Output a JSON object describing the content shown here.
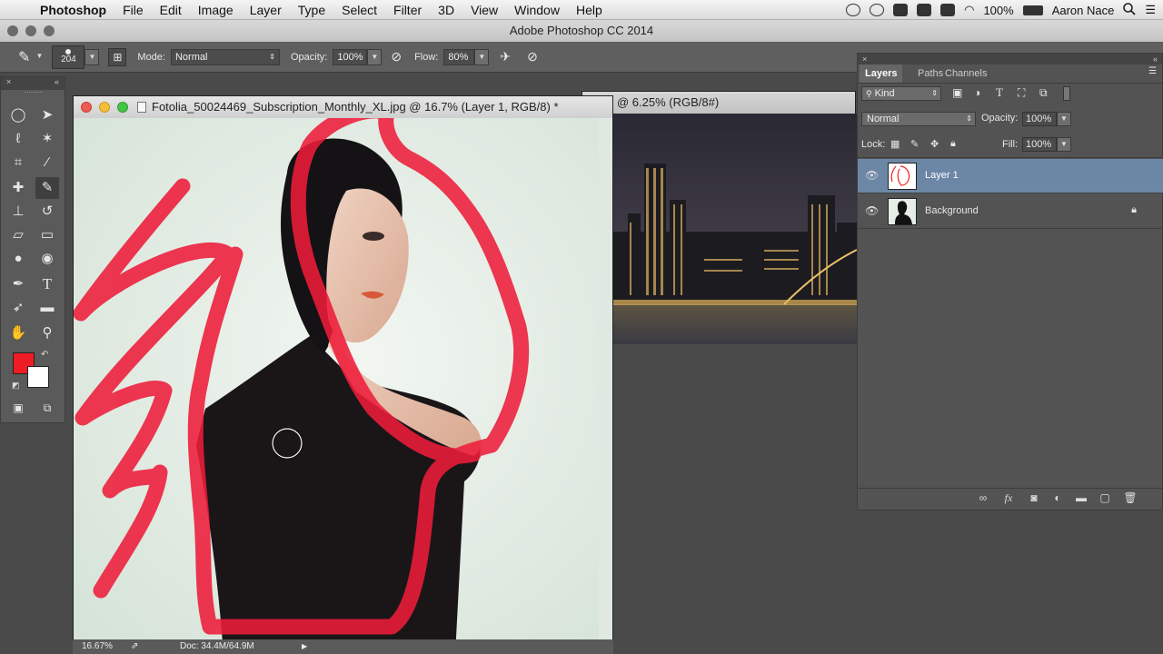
{
  "menubar": {
    "apple": "",
    "app": "Photoshop",
    "items": [
      "File",
      "Edit",
      "Image",
      "Layer",
      "Type",
      "Select",
      "Filter",
      "3D",
      "View",
      "Window",
      "Help"
    ],
    "battery": "100%",
    "user": "Aaron Nace"
  },
  "app_title": "Adobe Photoshop CC 2014",
  "options": {
    "brush_size": "204",
    "mode_label": "Mode:",
    "mode_value": "Normal",
    "opacity_label": "Opacity:",
    "opacity_value": "100%",
    "flow_label": "Flow:",
    "flow_value": "80%"
  },
  "toolbox": {
    "tools": [
      "marquee-icon",
      "move-icon",
      "lasso-icon",
      "magic-wand-icon",
      "crop-icon",
      "eyedropper-icon",
      "healing-icon",
      "brush-icon",
      "stamp-icon",
      "history-brush-icon",
      "eraser-icon",
      "gradient-icon",
      "blur-icon",
      "dodge-icon",
      "pen-icon",
      "type-icon",
      "path-select-icon",
      "shape-icon",
      "hand-icon",
      "zoom-icon"
    ],
    "foreground_color": "#ee1c24",
    "background_color": "#ffffff"
  },
  "documents": [
    {
      "title": "Fotolia_50024469_Subscription_Monthly_XL.jpg @ 16.7% (Layer 1, RGB/8) *",
      "zoom": "16.67%",
      "doc_info": "Doc: 34.4M/64.9M"
    },
    {
      "title_tail": "@ 6.25% (RGB/8#)"
    }
  ],
  "layers_panel": {
    "tabs": [
      "Layers",
      "Paths",
      "Channels"
    ],
    "kind_label": "Kind",
    "blend_mode": "Normal",
    "opacity_label": "Opacity:",
    "opacity_value": "100%",
    "lock_label": "Lock:",
    "fill_label": "Fill:",
    "fill_value": "100%",
    "layers": [
      {
        "name": "Layer 1",
        "selected": true
      },
      {
        "name": "Background",
        "locked": true
      }
    ]
  },
  "colors": {
    "accent_stroke": "#ee1c3a",
    "selection": "#6c86a6"
  }
}
